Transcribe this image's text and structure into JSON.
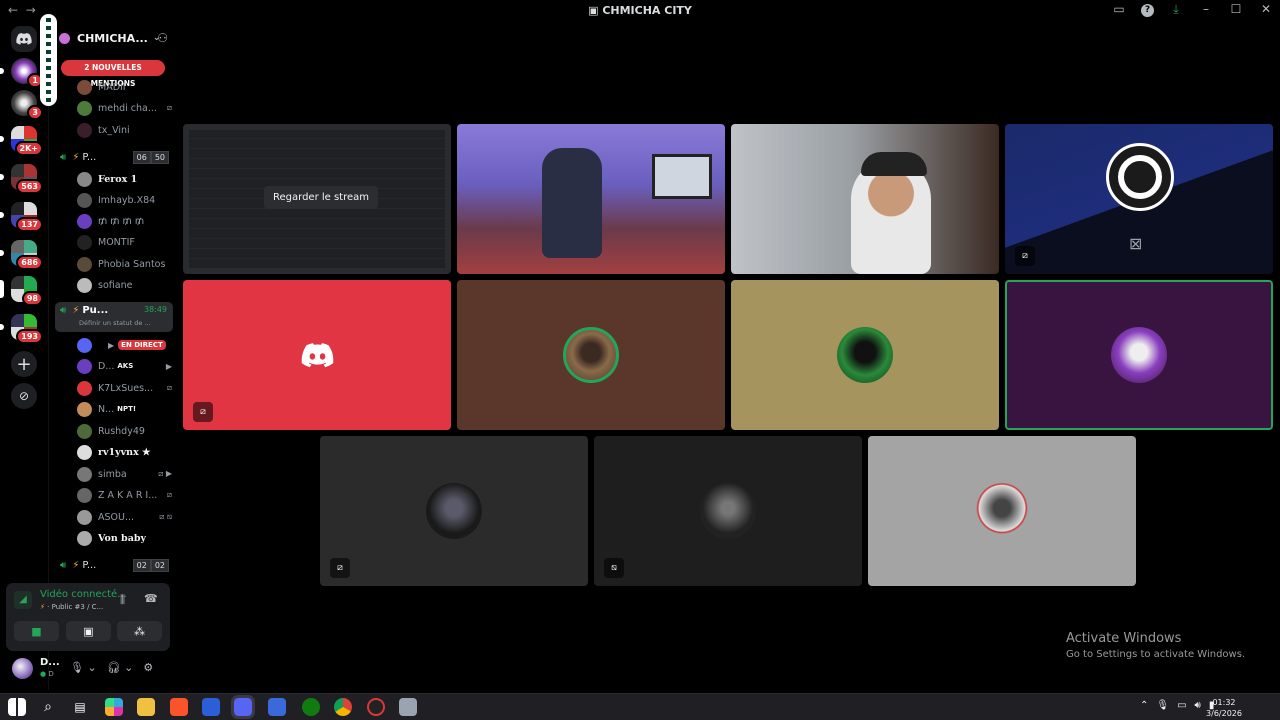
{
  "window": {
    "title": "CHMICHA CITY",
    "nav_back": "←",
    "nav_forward": "→"
  },
  "server": {
    "name": "CHMICHA...",
    "mentions_banner": "2 NOUVELLES MENTIONS"
  },
  "guild_badges": [
    "1",
    "3",
    "2K+",
    "563",
    "137",
    "686",
    "98",
    "193"
  ],
  "channel_users_top": [
    {
      "name": "MADII"
    },
    {
      "name": "mehdi cha..."
    },
    {
      "name": "tx_Vini"
    }
  ],
  "voice_channels": [
    {
      "name": "P...",
      "count_a": "06",
      "count_b": "50"
    },
    {
      "name": "Pu...",
      "time": "38:49",
      "status": "Définir un statut de ..."
    },
    {
      "name": "P...",
      "count_a": "02",
      "count_b": "02"
    }
  ],
  "channel1_users": [
    {
      "name": "Ferox 1"
    },
    {
      "name": "Imhayb.X84"
    },
    {
      "name": "₥ ₥ ₥ ₥"
    },
    {
      "name": "MONTIF"
    },
    {
      "name": "Phobia Santos"
    },
    {
      "name": "sofiane"
    }
  ],
  "channel2_users": [
    {
      "name": "D...",
      "tag": "AKS"
    },
    {
      "name": "K7LxSues..."
    },
    {
      "name": "N...",
      "tag": "NPT!"
    },
    {
      "name": "Rushdy49"
    },
    {
      "name": "rv1yvnx ★"
    },
    {
      "name": "simba"
    },
    {
      "name": "Z A K A R I..."
    },
    {
      "name": "ASOU..."
    },
    {
      "name": "Von baby"
    }
  ],
  "live_badge": "EN DIRECT",
  "voice_panel": {
    "title": "Vidéo connecté...",
    "subtitle": "Public #3 / C..."
  },
  "user_panel": {
    "name": "D...",
    "status": "D"
  },
  "stage": {
    "watch_stream": "Regarder le stream"
  },
  "watermark": {
    "line1": "Activate Windows",
    "line2": "Go to Settings to activate Windows."
  },
  "taskbar": {
    "time": "01:32",
    "date": "3/6/2026"
  },
  "colors": {
    "discord_red": "#da373c",
    "discord_green": "#23a55a",
    "tile_red": "#e13543",
    "tile_brown": "#5b372b",
    "tile_olive": "#a6945f",
    "tile_purple": "#3a1440"
  }
}
